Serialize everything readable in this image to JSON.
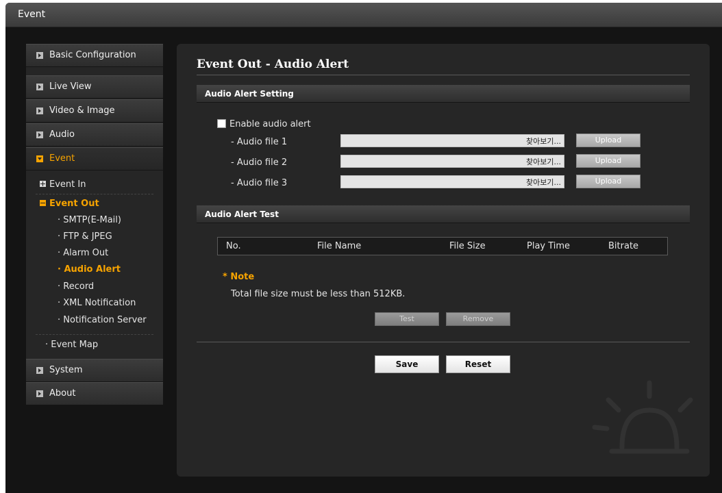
{
  "window": {
    "title": "Event"
  },
  "sidebar": {
    "items": [
      {
        "label": "Basic Configuration"
      },
      {
        "label": "Live View"
      },
      {
        "label": "Video & Image"
      },
      {
        "label": "Audio"
      },
      {
        "label": "Event"
      },
      {
        "label": "System"
      },
      {
        "label": "About"
      }
    ],
    "event_sub": {
      "event_in": "Event In",
      "event_out": "Event Out",
      "leaves": [
        "SMTP(E-Mail)",
        "FTP & JPEG",
        "Alarm Out",
        "Audio Alert",
        "Record",
        "XML Notification",
        "Notification Server"
      ],
      "event_map": "Event Map"
    }
  },
  "main": {
    "title": "Event Out - Audio Alert",
    "setting": {
      "header": "Audio Alert Setting",
      "enable_label": "Enable audio alert",
      "enable_checked": false,
      "files": [
        {
          "label": "- Audio file 1",
          "value": "",
          "browse": "찾아보기...",
          "upload": "Upload"
        },
        {
          "label": "- Audio file 2",
          "value": "",
          "browse": "찾아보기...",
          "upload": "Upload"
        },
        {
          "label": "- Audio file 3",
          "value": "",
          "browse": "찾아보기...",
          "upload": "Upload"
        }
      ]
    },
    "test": {
      "header": "Audio Alert Test",
      "columns": [
        "No.",
        "File Name",
        "File Size",
        "Play Time",
        "Bitrate"
      ],
      "rows": [],
      "note_title": "* Note",
      "note_text": "Total file size must be less than 512KB.",
      "test_button": "Test",
      "remove_button": "Remove"
    },
    "save_button": "Save",
    "reset_button": "Reset"
  },
  "colors": {
    "accent": "#f6a300",
    "background": "#141414",
    "panel": "#262626"
  }
}
